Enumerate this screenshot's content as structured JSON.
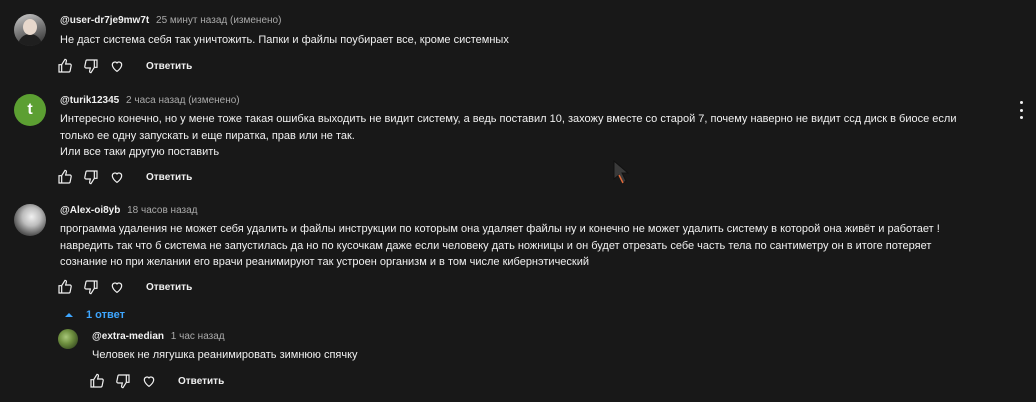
{
  "comments": [
    {
      "author": "@user-dr7je9mw7t",
      "time": "25 минут назад (изменено)",
      "text": "Не даст система себя так уничтожить. Папки и файлы поубирает все, кроме системных",
      "reply_label": "Ответить"
    },
    {
      "author": "@turik12345",
      "avatar_letter": "t",
      "time": "2 часа назад (изменено)",
      "text": "Интересно конечно, но у мене тоже такая ошибка выходить не видит систему, а ведь поставил 10, захожу вместе со старой 7, почему наверно не видит ссд диск в биосе если\nтолько ее одну запускать и еще пиратка, прав или не так.\nИли все таки другую поставить",
      "reply_label": "Ответить"
    },
    {
      "author": "@Alex-oi8yb",
      "time": "18 часов назад",
      "text": "программа удаления не может себя удалить и файлы инструкции по которым она удаляет файлы ну и конечно не может удалить систему в которой она живёт и работает  !\nнавредить так что б система не запустилась да  но по кусочкам даже если человеку дать ножницы и он будет отрезать себе часть тела по сантиметру он в итоге потеряет\nсознание но при желании его врачи реанимируют так устроен организм и в том числе кибернэтический",
      "reply_label": "Ответить",
      "replies_toggle": "1 ответ"
    }
  ],
  "reply": {
    "author": "@extra-median",
    "time": "1 час назад",
    "text": "Человек не лягушка реанимировать зимнюю спячку",
    "reply_label": "Ответить"
  },
  "colors": {
    "background": "#181818",
    "text": "#f1f1f1",
    "meta": "#aaaaaa",
    "link": "#3ea6ff",
    "avatar_letter_bg": "#5c9f32"
  }
}
